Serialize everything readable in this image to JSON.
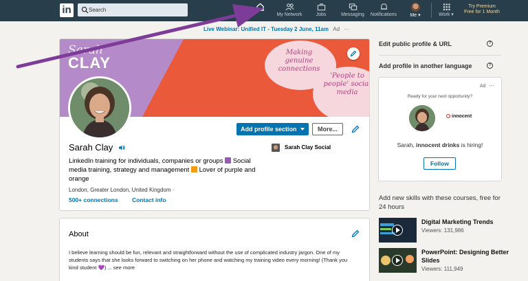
{
  "nav": {
    "logo": "in",
    "search_placeholder": "Search",
    "items": [
      {
        "label": "",
        "icon": "home-icon"
      },
      {
        "label": "My Network",
        "icon": "people-icon"
      },
      {
        "label": "Jobs",
        "icon": "briefcase-icon"
      },
      {
        "label": "Messaging",
        "icon": "messaging-icon"
      },
      {
        "label": "Notifications",
        "icon": "bell-icon"
      },
      {
        "label": "Me ▾",
        "icon": "avatar"
      },
      {
        "label": "Work ▾",
        "icon": "grid-icon"
      }
    ],
    "premium_line1": "Try Premium",
    "premium_line2": "Free for 1 Month"
  },
  "webinar": {
    "link": "Live Webinar: Unified IT",
    "text": " - Tuesday 2 June, 11am",
    "ad": "Ad",
    "dots": "···"
  },
  "banner": {
    "name_script": "Sarah",
    "name_caps": "CLAY",
    "bubble1": "Making genuine connections",
    "bubble2": "'People to people' social media",
    "colors": {
      "purple": "#b58ac8",
      "orange": "#e9593a",
      "pink": "#f7d7de"
    }
  },
  "profile": {
    "name": "Sarah Clay",
    "headline_1": "LinkedIn training for individuals, companies or groups ",
    "headline_2": " Social media training, strategy and management ",
    "headline_3": " Lover of purple and orange",
    "location": "London, Greater London, United Kingdom ·",
    "connections": "500+ connections",
    "contact": "Contact info",
    "company": "Sarah Clay Social",
    "add_section": "Add profile section",
    "more": "More..."
  },
  "about": {
    "title": "About",
    "text": "I believe learning should be fun, relevant and straightforward without the use of complicated industry jargon. One of my students says that she looks forward to switching on her phone and watching my training video every morning! (Thank you kind student 💜) ... see more"
  },
  "rail": {
    "edit_url": "Edit public profile & URL",
    "add_language": "Add profile in another language",
    "ad_label": "Ad",
    "ad_dots": "···",
    "ad_tagline": "Ready for your next opportunity?",
    "ad_company": "innocent",
    "ad_text_1": "Sarah, ",
    "ad_text_2": "innocent drinks",
    "ad_text_3": " is hiring!",
    "follow": "Follow",
    "courses_title": "Add new skills with these courses, free for 24 hours",
    "courses": [
      {
        "title": "Digital Marketing Trends",
        "viewers": "Viewers: 131,986"
      },
      {
        "title": "PowerPoint: Designing Better Slides",
        "viewers": "Viewers: 111,949"
      }
    ]
  },
  "colors": {
    "nav": "#283e4a",
    "link": "#0073b1",
    "annotation_arrow": "#7d3c98"
  }
}
